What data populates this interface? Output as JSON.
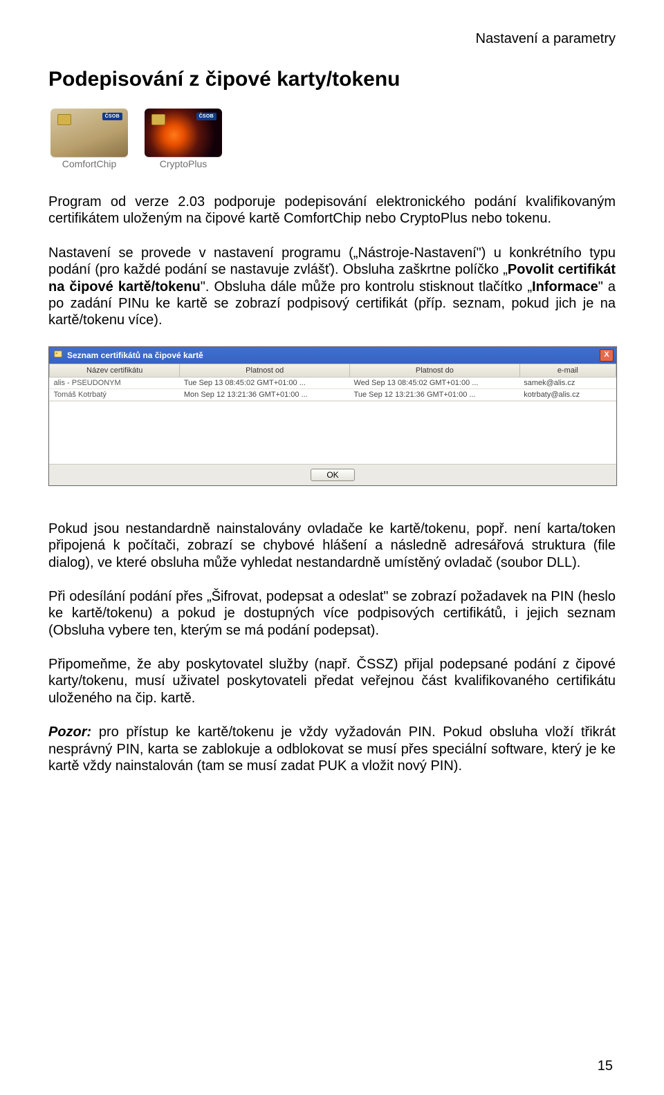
{
  "page_header": "Nastavení a parametry",
  "section_title": "Podepisování z čipové karty/tokenu",
  "cards": {
    "comfort_label": "ComfortChip",
    "crypto_label": "CryptoPlus",
    "csob_badge": "ČSOB"
  },
  "paragraphs": {
    "p1": "Program od verze 2.03 podporuje podepisování elektronického podání kvalifikovaným certifikátem uloženým na čipové kartě ComfortChip nebo CryptoPlus nebo tokenu.",
    "p2_a": "Nastavení se provede v nastavení programu („Nástroje-Nastavení\") u konkrétního typu podání (pro každé podání se nastavuje zvlášť). Obsluha zaškrtne políčko „",
    "p2_bold": "Povolit certifikát na čipové kartě/tokenu",
    "p2_b": "\". Obsluha dále může pro kontrolu stisknout tlačítko „",
    "p2_bold2": "Informace",
    "p2_c": "\" a po zadání PINu ke kartě se zobrazí podpisový certifikát (příp. seznam, pokud jich je na kartě/tokenu více).",
    "p3": "Pokud jsou nestandardně nainstalovány ovladače ke kartě/tokenu, popř. není karta/token připojená k počítači, zobrazí se chybové hlášení a následně adresářová struktura (file dialog), ve které obsluha může vyhledat nestandardně umístěný ovladač (soubor DLL).",
    "p4": "Při odesílání podání přes „Šifrovat, podepsat a odeslat\" se zobrazí požadavek na PIN (heslo ke kartě/tokenu) a pokud je dostupných více podpisových certifikátů, i jejich seznam (Obsluha vybere ten, kterým se má podání podepsat).",
    "p5": "Připomeňme, že aby poskytovatel služby (např. ČSSZ) přijal podepsané podání z čipové karty/tokenu, musí uživatel poskytovateli předat veřejnou část kvalifikovaného certifikátu uloženého na čip. kartě.",
    "p6_label": "Pozor:",
    "p6_body": " pro přístup ke kartě/tokenu je vždy vyžadován PIN. Pokud obsluha vloží třikrát nesprávný PIN, karta se zablokuje a odblokovat se musí přes speciální software, který je ke kartě vždy nainstalován (tam se musí zadat PUK a vložit nový PIN)."
  },
  "dialog": {
    "title": "Seznam certifikátů na čipové kartě",
    "close_glyph": "X",
    "ok_label": "OK",
    "columns": {
      "c0": "Název certifikátu",
      "c1": "Platnost od",
      "c2": "Platnost do",
      "c3": "e-mail"
    },
    "rows": [
      {
        "c0": "alis - PSEUDONYM",
        "c1": "Tue Sep 13 08:45:02 GMT+01:00 ...",
        "c2": "Wed Sep 13 08:45:02 GMT+01:00 ...",
        "c3": "samek@alis.cz"
      },
      {
        "c0": "Tomáš Kotrbatý",
        "c1": "Mon Sep 12 13:21:36 GMT+01:00 ...",
        "c2": "Tue Sep 12 13:21:36 GMT+01:00 ...",
        "c3": "kotrbaty@alis.cz"
      }
    ]
  },
  "page_number": "15"
}
